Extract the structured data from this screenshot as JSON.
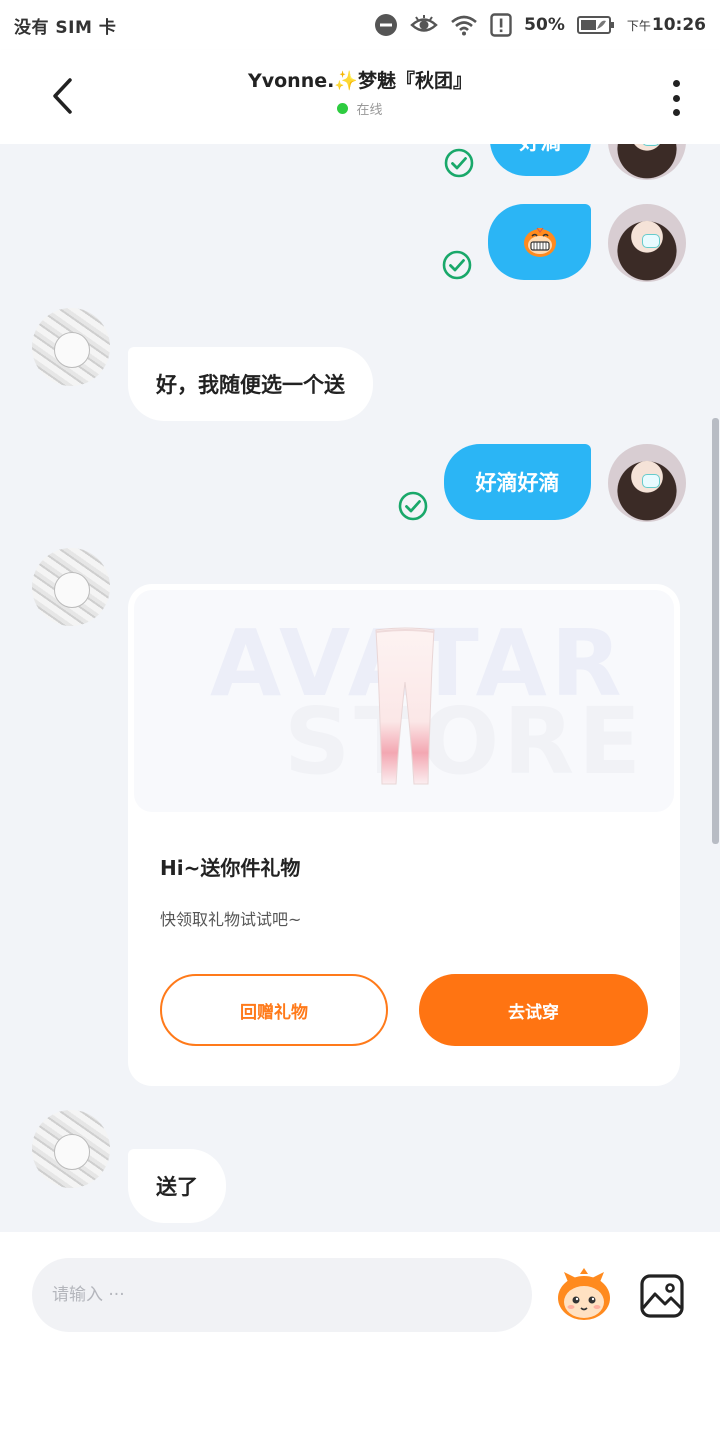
{
  "status_bar": {
    "carrier": "没有 SIM 卡",
    "battery": "50%",
    "time_prefix": "下午",
    "time": "10:26"
  },
  "header": {
    "title": "Yvonne.✨梦魅『秋团』",
    "status": "在线"
  },
  "messages": [
    {
      "from": "self",
      "text": "好滴"
    },
    {
      "from": "self",
      "type": "sticker",
      "icon": "grinning-monkey-sticker"
    },
    {
      "from": "other",
      "text": "好，我随便选一个送"
    },
    {
      "from": "self",
      "text": "好滴好滴"
    },
    {
      "from": "other",
      "text": "送了"
    }
  ],
  "gift_card": {
    "watermark_line1": "AVATAR",
    "watermark_line2": "STORE",
    "title": "Hi~送你件礼物",
    "description": "快领取礼物试试吧~",
    "return_gift_label": "回赠礼物",
    "try_on_label": "去试穿"
  },
  "input": {
    "placeholder": "请输入 ···"
  },
  "colors": {
    "self_bubble": "#2bb5f5",
    "accent_orange": "#ff7412",
    "online_green": "#2ecc40",
    "read_check_green": "#19a86a",
    "chat_background": "#f2f4f8"
  }
}
